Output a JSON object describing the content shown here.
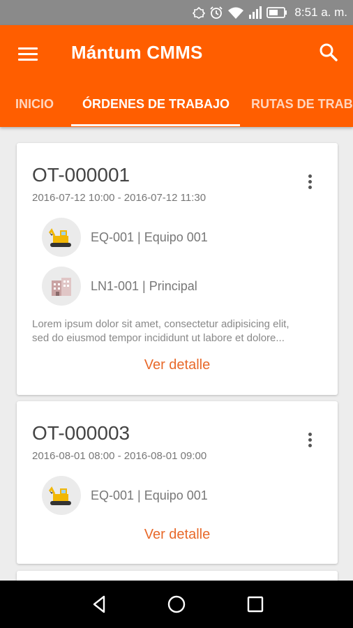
{
  "status_bar": {
    "time": "8:51 a. m.",
    "icons": [
      "notification-icon",
      "alarm-icon",
      "wifi-icon",
      "signal-icon",
      "battery-icon"
    ]
  },
  "app_bar": {
    "title": "Mántum CMMS",
    "menu_icon": "menu-icon",
    "search_icon": "search-icon",
    "color": "#ff5e00"
  },
  "tabs": [
    {
      "label": "INICIO",
      "active": false
    },
    {
      "label": "ÓRDENES DE TRABAJO",
      "active": true
    },
    {
      "label": "RUTAS DE TRABA",
      "active": false
    }
  ],
  "orders": [
    {
      "title": "OT-000001",
      "dates": "2016-07-12 10:00 - 2016-07-12 11:30",
      "equipment": {
        "icon": "excavator-icon",
        "label": "EQ-001 | Equipo 001"
      },
      "location": {
        "icon": "building-icon",
        "label": "LN1-001 | Principal"
      },
      "description_lines": [
        "Lorem ipsum dolor sit amet, consectetur adipisicing elit,",
        "sed do eiusmod tempor incididunt ut labore et dolore..."
      ],
      "link": "Ver detalle"
    },
    {
      "title": "OT-000003",
      "dates": "2016-08-01 08:00 - 2016-08-01 09:00",
      "equipment": {
        "icon": "excavator-icon",
        "label": "EQ-001 | Equipo 001"
      },
      "link": "Ver detalle"
    }
  ],
  "nav_bar": {
    "icons": [
      "back-icon",
      "home-icon",
      "recents-icon"
    ]
  },
  "colors": {
    "accent": "#ff5e00",
    "link": "#e8692a",
    "status_bar": "#8a8a8a"
  }
}
